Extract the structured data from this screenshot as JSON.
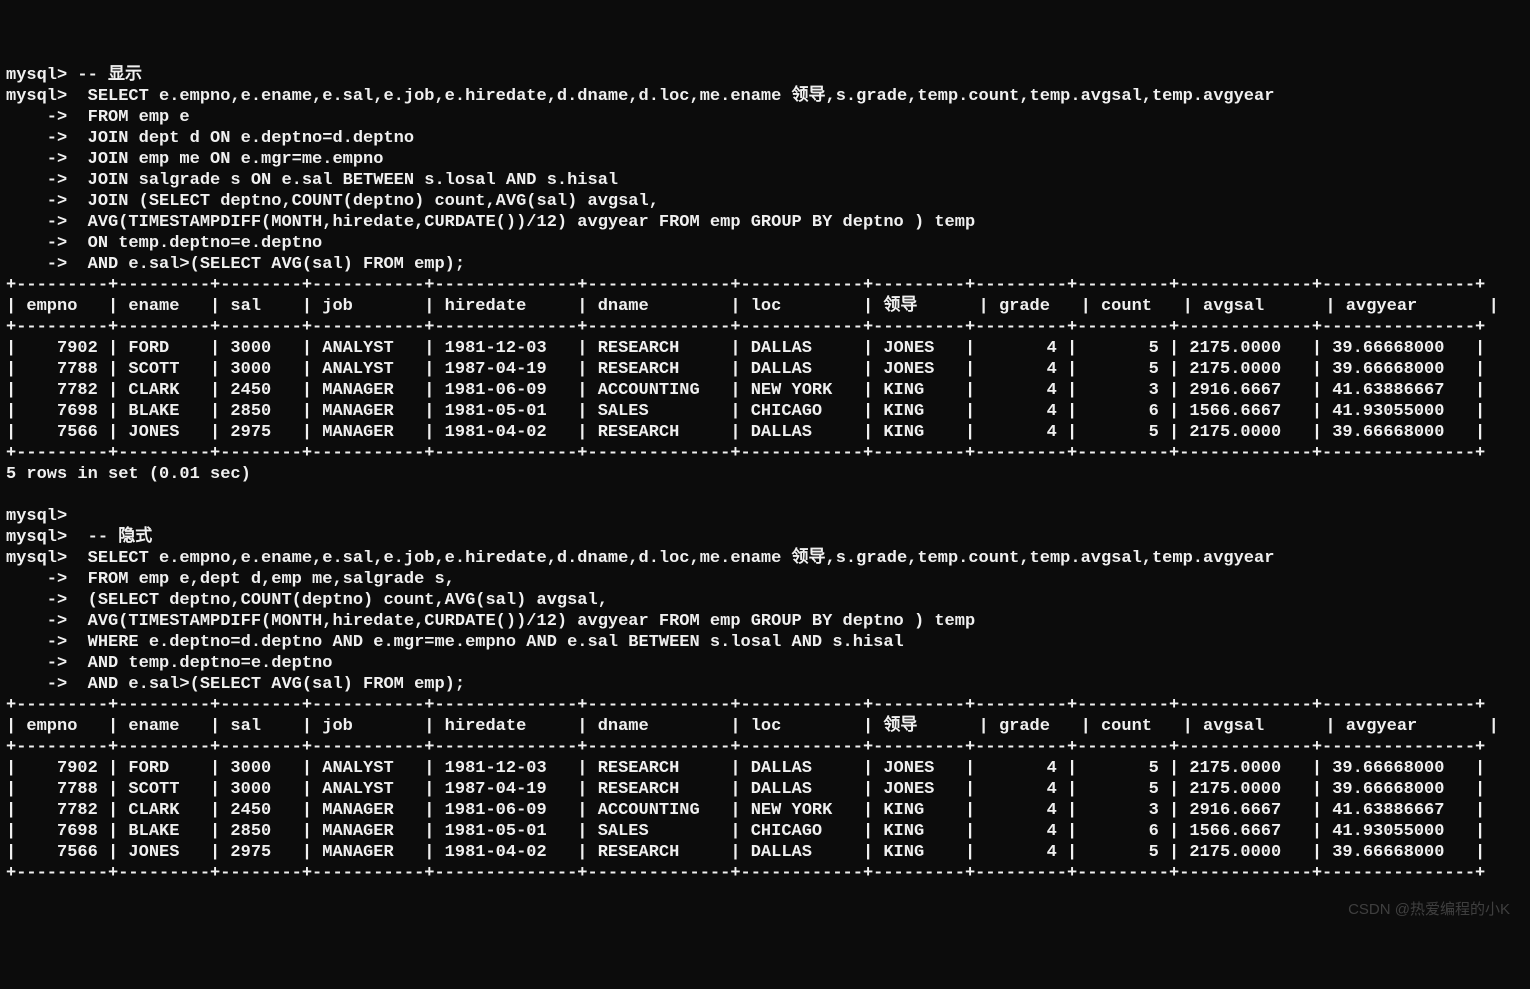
{
  "prompts": {
    "mysql": "mysql>",
    "cont": "    ->"
  },
  "block1": {
    "comment": "-- 显示",
    "query": [
      " SELECT e.empno,e.ename,e.sal,e.job,e.hiredate,d.dname,d.loc,me.ename 领导,s.grade,temp.count,temp.avgsal,temp.avgyear",
      " FROM emp e",
      " JOIN dept d ON e.deptno=d.deptno",
      " JOIN emp me ON e.mgr=me.empno",
      " JOIN salgrade s ON e.sal BETWEEN s.losal AND s.hisal",
      " JOIN (SELECT deptno,COUNT(deptno) count,AVG(sal) avgsal,",
      " AVG(TIMESTAMPDIFF(MONTH,hiredate,CURDATE())/12) avgyear FROM emp GROUP BY deptno ) temp",
      " ON temp.deptno=e.deptno",
      " AND e.sal>(SELECT AVG(sal) FROM emp);"
    ]
  },
  "block2": {
    "comment": " -- 隐式",
    "query": [
      " SELECT e.empno,e.ename,e.sal,e.job,e.hiredate,d.dname,d.loc,me.ename 领导,s.grade,temp.count,temp.avgsal,temp.avgyear",
      " FROM emp e,dept d,emp me,salgrade s,",
      " (SELECT deptno,COUNT(deptno) count,AVG(sal) avgsal,",
      " AVG(TIMESTAMPDIFF(MONTH,hiredate,CURDATE())/12) avgyear FROM emp GROUP BY deptno ) temp",
      " WHERE e.deptno=d.deptno AND e.mgr=me.empno AND e.sal BETWEEN s.losal AND s.hisal",
      " AND temp.deptno=e.deptno",
      " AND e.sal>(SELECT AVG(sal) FROM emp);"
    ]
  },
  "table": {
    "headers": [
      "empno",
      "ename",
      "sal",
      "job",
      "hiredate",
      "dname",
      "loc",
      "领导",
      "grade",
      "count",
      "avgsal",
      "avgyear"
    ],
    "widths": [
      7,
      7,
      6,
      9,
      12,
      12,
      10,
      7,
      7,
      7,
      11,
      13
    ],
    "align": [
      "r",
      "l",
      "l",
      "l",
      "l",
      "l",
      "l",
      "l",
      "r",
      "r",
      "l",
      "l"
    ],
    "rows": [
      [
        "7902",
        "FORD",
        "3000",
        "ANALYST",
        "1981-12-03",
        "RESEARCH",
        "DALLAS",
        "JONES",
        "4",
        "5",
        "2175.0000",
        "39.66668000"
      ],
      [
        "7788",
        "SCOTT",
        "3000",
        "ANALYST",
        "1987-04-19",
        "RESEARCH",
        "DALLAS",
        "JONES",
        "4",
        "5",
        "2175.0000",
        "39.66668000"
      ],
      [
        "7782",
        "CLARK",
        "2450",
        "MANAGER",
        "1981-06-09",
        "ACCOUNTING",
        "NEW YORK",
        "KING",
        "4",
        "3",
        "2916.6667",
        "41.63886667"
      ],
      [
        "7698",
        "BLAKE",
        "2850",
        "MANAGER",
        "1981-05-01",
        "SALES",
        "CHICAGO",
        "KING",
        "4",
        "6",
        "1566.6667",
        "41.93055000"
      ],
      [
        "7566",
        "JONES",
        "2975",
        "MANAGER",
        "1981-04-02",
        "RESEARCH",
        "DALLAS",
        "KING",
        "4",
        "5",
        "2175.0000",
        "39.66668000"
      ]
    ]
  },
  "status": "5 rows in set (0.01 sec)",
  "watermark": "CSDN @热爱编程的小K"
}
